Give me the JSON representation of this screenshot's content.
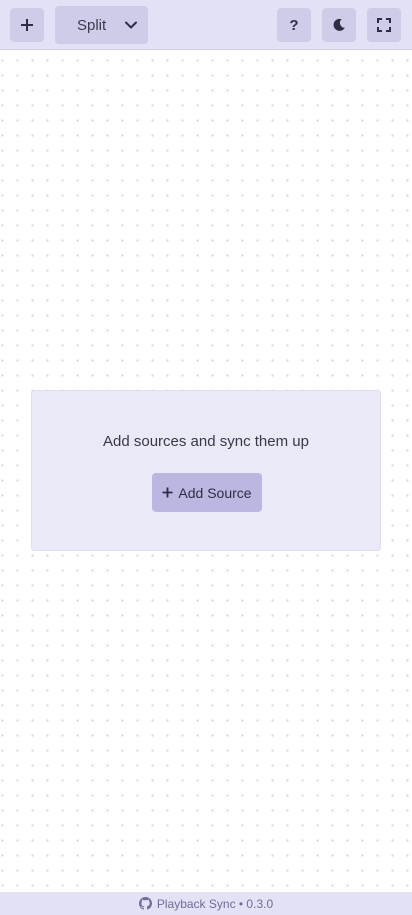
{
  "toolbar": {
    "add_icon": "plus-icon",
    "layout_select": {
      "value": "Split",
      "icon": "chevron-down-icon"
    },
    "help_label": "?",
    "theme_icon": "moon-icon",
    "fullscreen_icon": "fullscreen-icon"
  },
  "empty_state": {
    "message": "Add sources and sync them up",
    "button_label": "Add Source",
    "button_icon": "plus-icon"
  },
  "footer": {
    "icon": "github-icon",
    "text": "Playback Sync • 0.3.0"
  },
  "colors": {
    "toolbar_bg": "#e3e1f5",
    "button_bg": "#cfcce9",
    "card_bg": "#eae9f8",
    "primary_button": "#bab7e1",
    "footer_text": "#6f6c9a"
  }
}
